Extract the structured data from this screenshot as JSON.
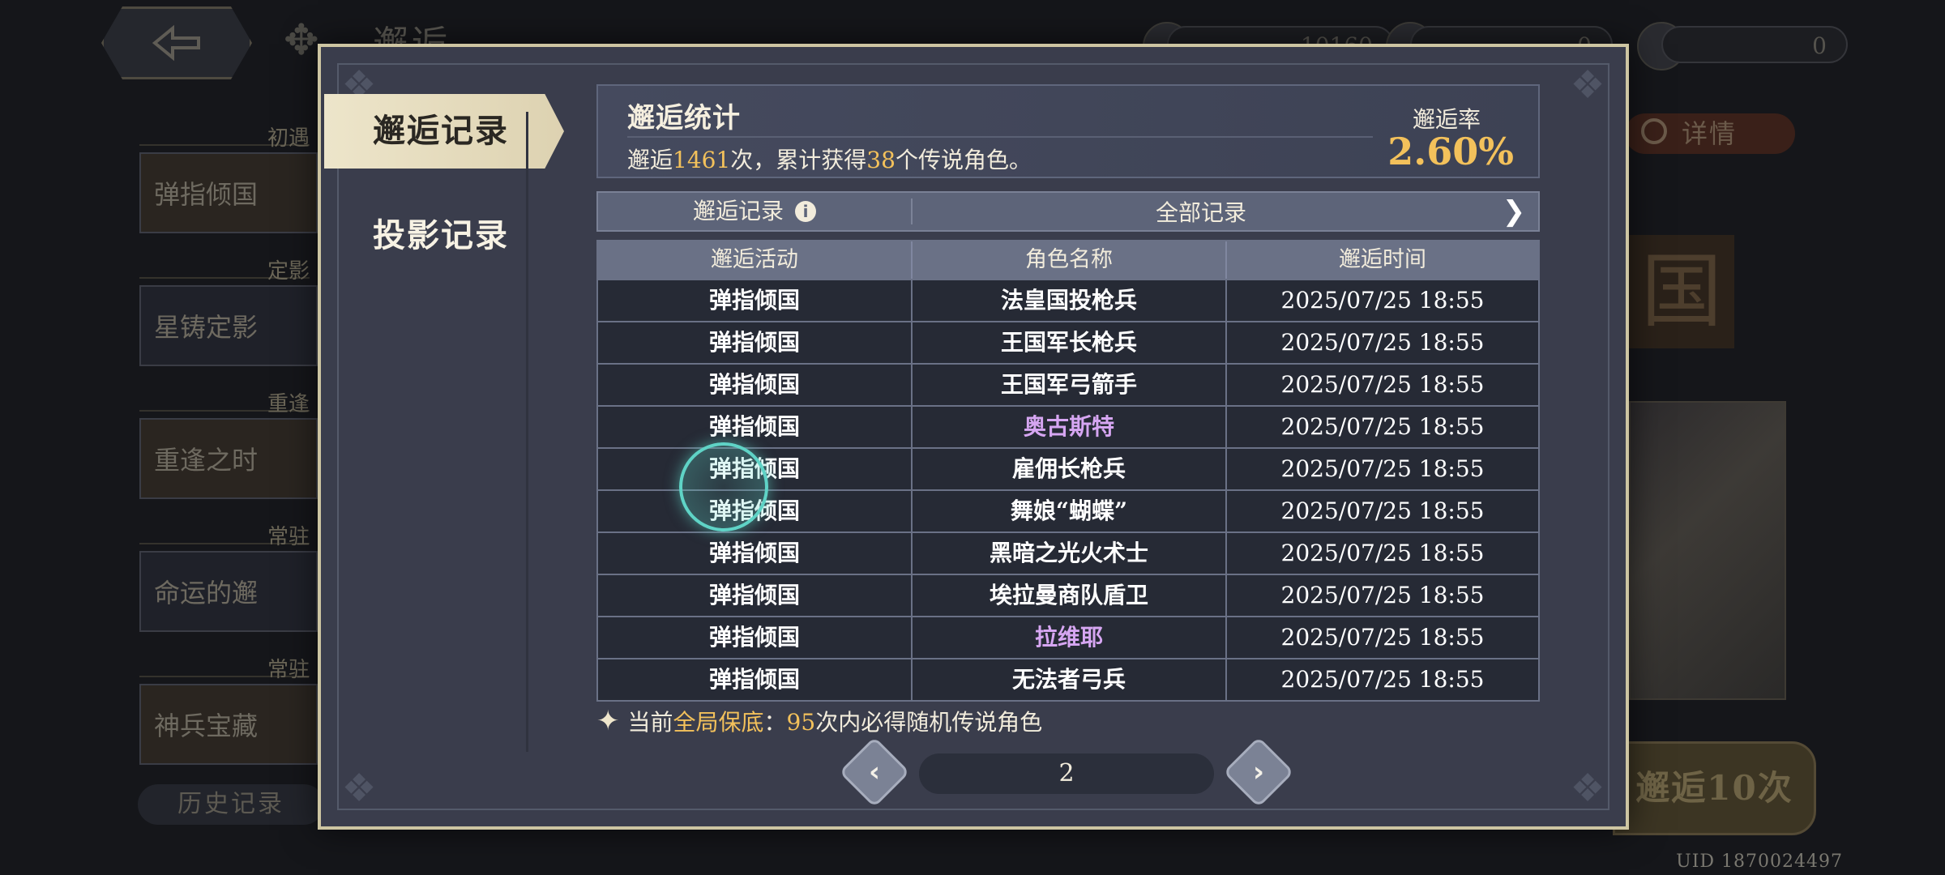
{
  "background": {
    "title": "邂逅",
    "resources": [
      "10160",
      "0",
      "0"
    ],
    "banners": [
      {
        "category": "初遇",
        "name": "弹指倾国"
      },
      {
        "category": "定影",
        "name": "星铸定影"
      },
      {
        "category": "重逢",
        "name": "重逢之时"
      },
      {
        "category": "常驻",
        "name": "命运的邂"
      },
      {
        "category": "常驻",
        "name": "神兵宝藏"
      }
    ],
    "history_label": "历史记录",
    "detail_label": "详情",
    "banner_glyph": "国",
    "pull_ten_label": "邂逅10次",
    "uid": "UID 1870024497"
  },
  "sidebar": {
    "tabs": [
      {
        "label": "邂逅记录",
        "active": true
      },
      {
        "label": "投影记录",
        "active": false
      }
    ]
  },
  "stats": {
    "title": "邂逅统计",
    "text_prefix": "邂逅",
    "count": "1461",
    "text_mid": "次，累计获得",
    "legend_count": "38",
    "text_suffix": "个传说角色。",
    "rate_label": "邂逅率",
    "rate_value": "2.60%"
  },
  "filter": {
    "left_label": "邂逅记录",
    "right_label": "全部记录"
  },
  "table": {
    "headers": [
      "邂逅活动",
      "角色名称",
      "邂逅时间"
    ],
    "rows": [
      {
        "activity": "弹指倾国",
        "name": "法皇国投枪兵",
        "time": "2025/07/25 18:55",
        "legend": false
      },
      {
        "activity": "弹指倾国",
        "name": "王国军长枪兵",
        "time": "2025/07/25 18:55",
        "legend": false
      },
      {
        "activity": "弹指倾国",
        "name": "王国军弓箭手",
        "time": "2025/07/25 18:55",
        "legend": false
      },
      {
        "activity": "弹指倾国",
        "name": "奥古斯特",
        "time": "2025/07/25 18:55",
        "legend": true
      },
      {
        "activity": "弹指倾国",
        "name": "雇佣长枪兵",
        "time": "2025/07/25 18:55",
        "legend": false
      },
      {
        "activity": "弹指倾国",
        "name": "舞娘“蝴蝶”",
        "time": "2025/07/25 18:55",
        "legend": false
      },
      {
        "activity": "弹指倾国",
        "name": "黑暗之光火术士",
        "time": "2025/07/25 18:55",
        "legend": false
      },
      {
        "activity": "弹指倾国",
        "name": "埃拉曼商队盾卫",
        "time": "2025/07/25 18:55",
        "legend": false
      },
      {
        "activity": "弹指倾国",
        "name": "拉维耶",
        "time": "2025/07/25 18:55",
        "legend": true
      },
      {
        "activity": "弹指倾国",
        "name": "无法者弓兵",
        "time": "2025/07/25 18:55",
        "legend": false
      }
    ]
  },
  "pity": {
    "prefix": "当前",
    "highlight": "全局保底",
    "colon": "：",
    "count": "95",
    "suffix": "次内必得随机传说角色"
  },
  "pager": {
    "current_page": "2"
  },
  "colors": {
    "gold": "#f3c15b",
    "legend_name": "#d6a6f2",
    "panel": "#3a3d4c",
    "touch_ring": "#5fd3c6"
  }
}
